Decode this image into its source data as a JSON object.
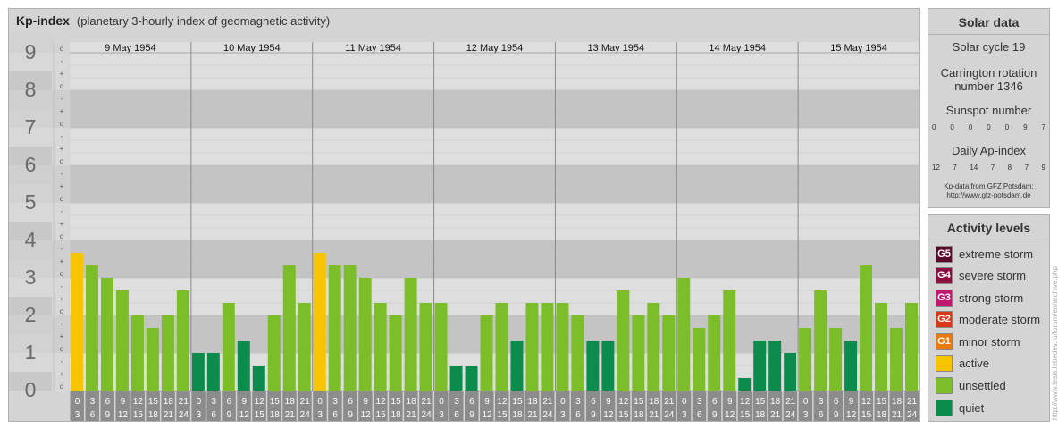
{
  "header": {
    "title": "Kp-index",
    "subtitle": "(planetary 3-hourly index of geomagnetic activity)"
  },
  "chart_data": {
    "type": "bar",
    "title": "Kp-index",
    "ylim": [
      0,
      9
    ],
    "y_ticks": [
      "0",
      "1",
      "2",
      "3",
      "4",
      "5",
      "6",
      "7",
      "8",
      "9"
    ],
    "sub_ticks": [
      "o",
      "+",
      "-"
    ],
    "days": [
      "9 May 1954",
      "10 May 1954",
      "11 May 1954",
      "12 May 1954",
      "13 May 1954",
      "14 May 1954",
      "15 May 1954"
    ],
    "interval_labels": [
      [
        "0",
        "3"
      ],
      [
        "3",
        "6"
      ],
      [
        "6",
        "9"
      ],
      [
        "9",
        "12"
      ],
      [
        "12",
        "15"
      ],
      [
        "15",
        "18"
      ],
      [
        "18",
        "21"
      ],
      [
        "21",
        "24"
      ]
    ],
    "values": [
      [
        3.667,
        3.333,
        3.0,
        2.667,
        2.0,
        1.667,
        2.0,
        2.667
      ],
      [
        1.0,
        1.0,
        2.333,
        1.333,
        0.667,
        2.0,
        3.333,
        2.333
      ],
      [
        3.667,
        3.333,
        3.333,
        3.0,
        2.333,
        2.0,
        3.0,
        2.333
      ],
      [
        2.333,
        0.667,
        0.667,
        2.0,
        2.333,
        1.333,
        2.333,
        2.333
      ],
      [
        2.333,
        2.0,
        1.333,
        1.333,
        2.667,
        2.0,
        2.333,
        2.0
      ],
      [
        3.0,
        1.667,
        2.0,
        2.667,
        0.333,
        1.333,
        1.333,
        1.0
      ],
      [
        1.667,
        2.667,
        1.667,
        1.333,
        3.333,
        2.333,
        1.667,
        2.333
      ]
    ],
    "colors": {
      "quiet": "#0c8c4c",
      "unsettled": "#7cbe2a",
      "active": "#f8c400",
      "band_dark": "#c4c4c4",
      "band_light": "#dedede",
      "tick_box": "#8c8c8c"
    },
    "grid": true
  },
  "solar": {
    "title": "Solar data",
    "cycle": "Solar cycle 19",
    "carrington_line1": "Carrington rotation",
    "carrington_line2": "number 1346",
    "sunspot_label": "Sunspot number",
    "sunspot_values": [
      "0",
      "0",
      "0",
      "0",
      "0",
      "9",
      "7"
    ],
    "ap_label": "Daily Ap-index",
    "ap_values": [
      "12",
      "7",
      "14",
      "7",
      "8",
      "7",
      "9"
    ],
    "source_line1": "Kp-data from GFZ Potsdam:",
    "source_line2": "http://www.gfz-potsdam.de"
  },
  "activity": {
    "title": "Activity levels",
    "items": [
      {
        "code": "G5",
        "label": "extreme storm",
        "color": "#5a0a2a"
      },
      {
        "code": "G4",
        "label": "severe storm",
        "color": "#8a1040"
      },
      {
        "code": "G3",
        "label": "strong storm",
        "color": "#c01870"
      },
      {
        "code": "G2",
        "label": "moderate storm",
        "color": "#d83818"
      },
      {
        "code": "G1",
        "label": "minor storm",
        "color": "#e87a10"
      },
      {
        "code": "",
        "label": "active",
        "color": "#f8c400"
      },
      {
        "code": "",
        "label": "unsettled",
        "color": "#7cbe2a"
      },
      {
        "code": "",
        "label": "quiet",
        "color": "#0c8c4c"
      }
    ]
  },
  "watermark": "http://www.tesis.lebedev.ru/forum/en/archive.php"
}
